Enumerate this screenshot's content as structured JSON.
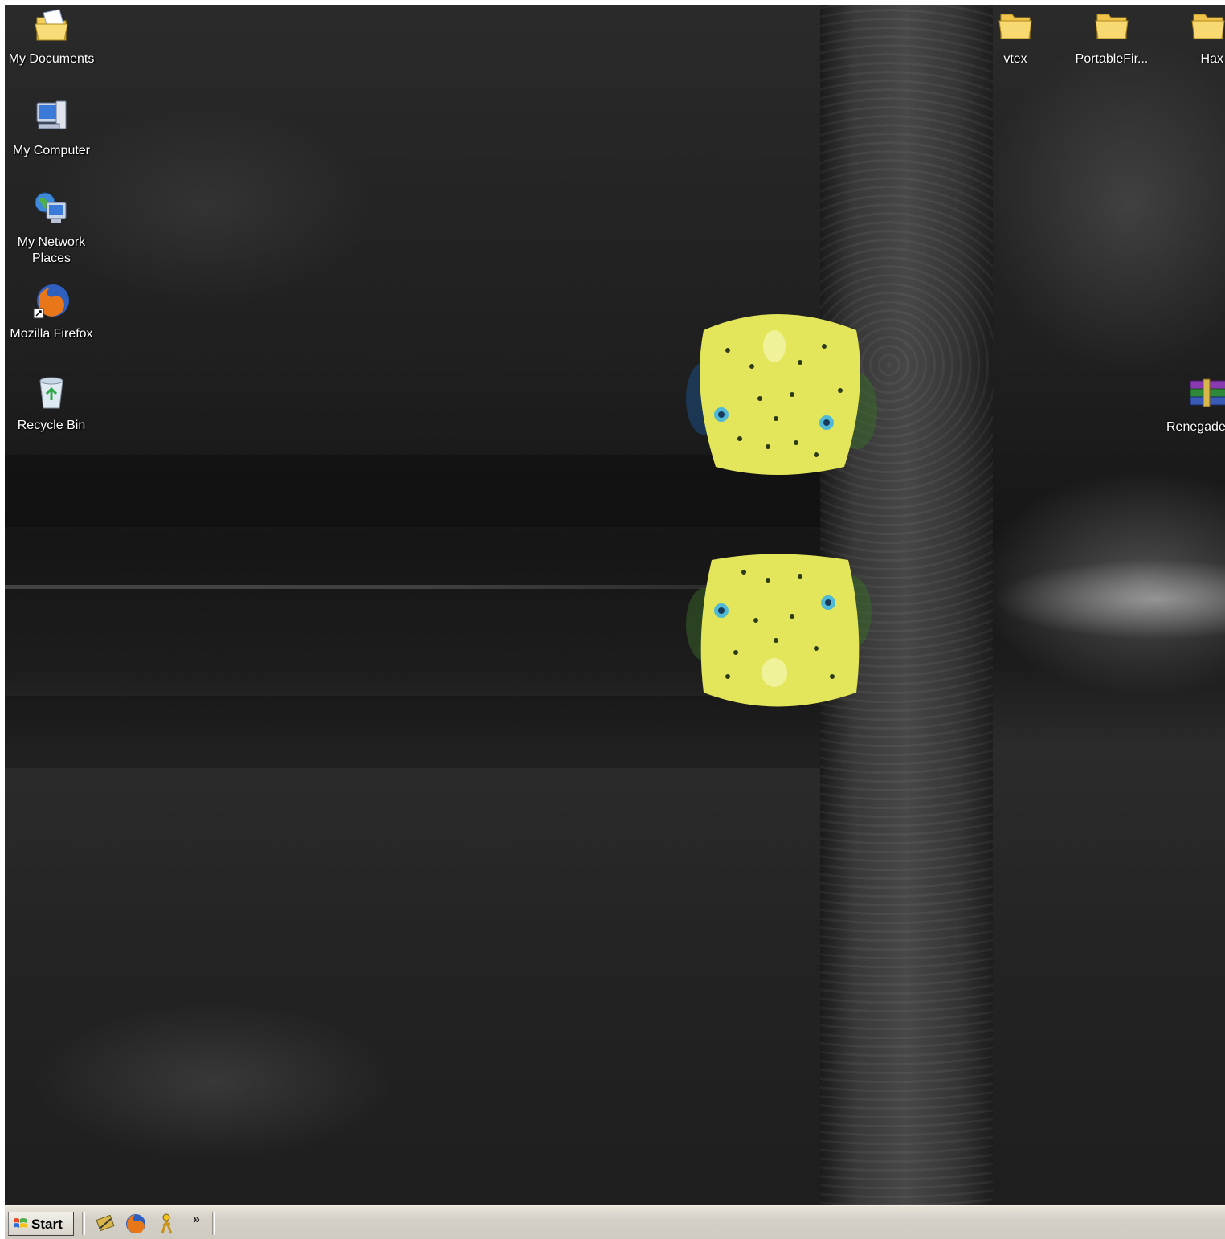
{
  "desktop": {
    "icons_left": [
      {
        "label": "My Documents",
        "icon": "my-documents-icon"
      },
      {
        "label": "My Computer",
        "icon": "my-computer-icon"
      },
      {
        "label": "My Network Places",
        "icon": "network-places-icon"
      },
      {
        "label": "Mozilla Firefox",
        "icon": "firefox-icon"
      },
      {
        "label": "Recycle Bin",
        "icon": "recycle-bin-icon"
      }
    ],
    "icons_right": [
      {
        "label": "vtex",
        "icon": "folder-icon"
      },
      {
        "label": "PortableFir...",
        "icon": "folder-icon"
      },
      {
        "label": "Hax",
        "icon": "folder-icon"
      },
      {
        "label": "Renegade",
        "icon": "winrar-archive-icon"
      }
    ]
  },
  "taskbar": {
    "start_label": "Start",
    "quick_launch": [
      {
        "name": "show-desktop-icon"
      },
      {
        "name": "firefox-icon"
      },
      {
        "name": "aim-icon"
      }
    ],
    "overflow_label": "»"
  },
  "colors": {
    "taskbar": "#d4d0c8",
    "fish_yellow": "#e6e85a",
    "desktop_dark": "#1e1e1e"
  }
}
